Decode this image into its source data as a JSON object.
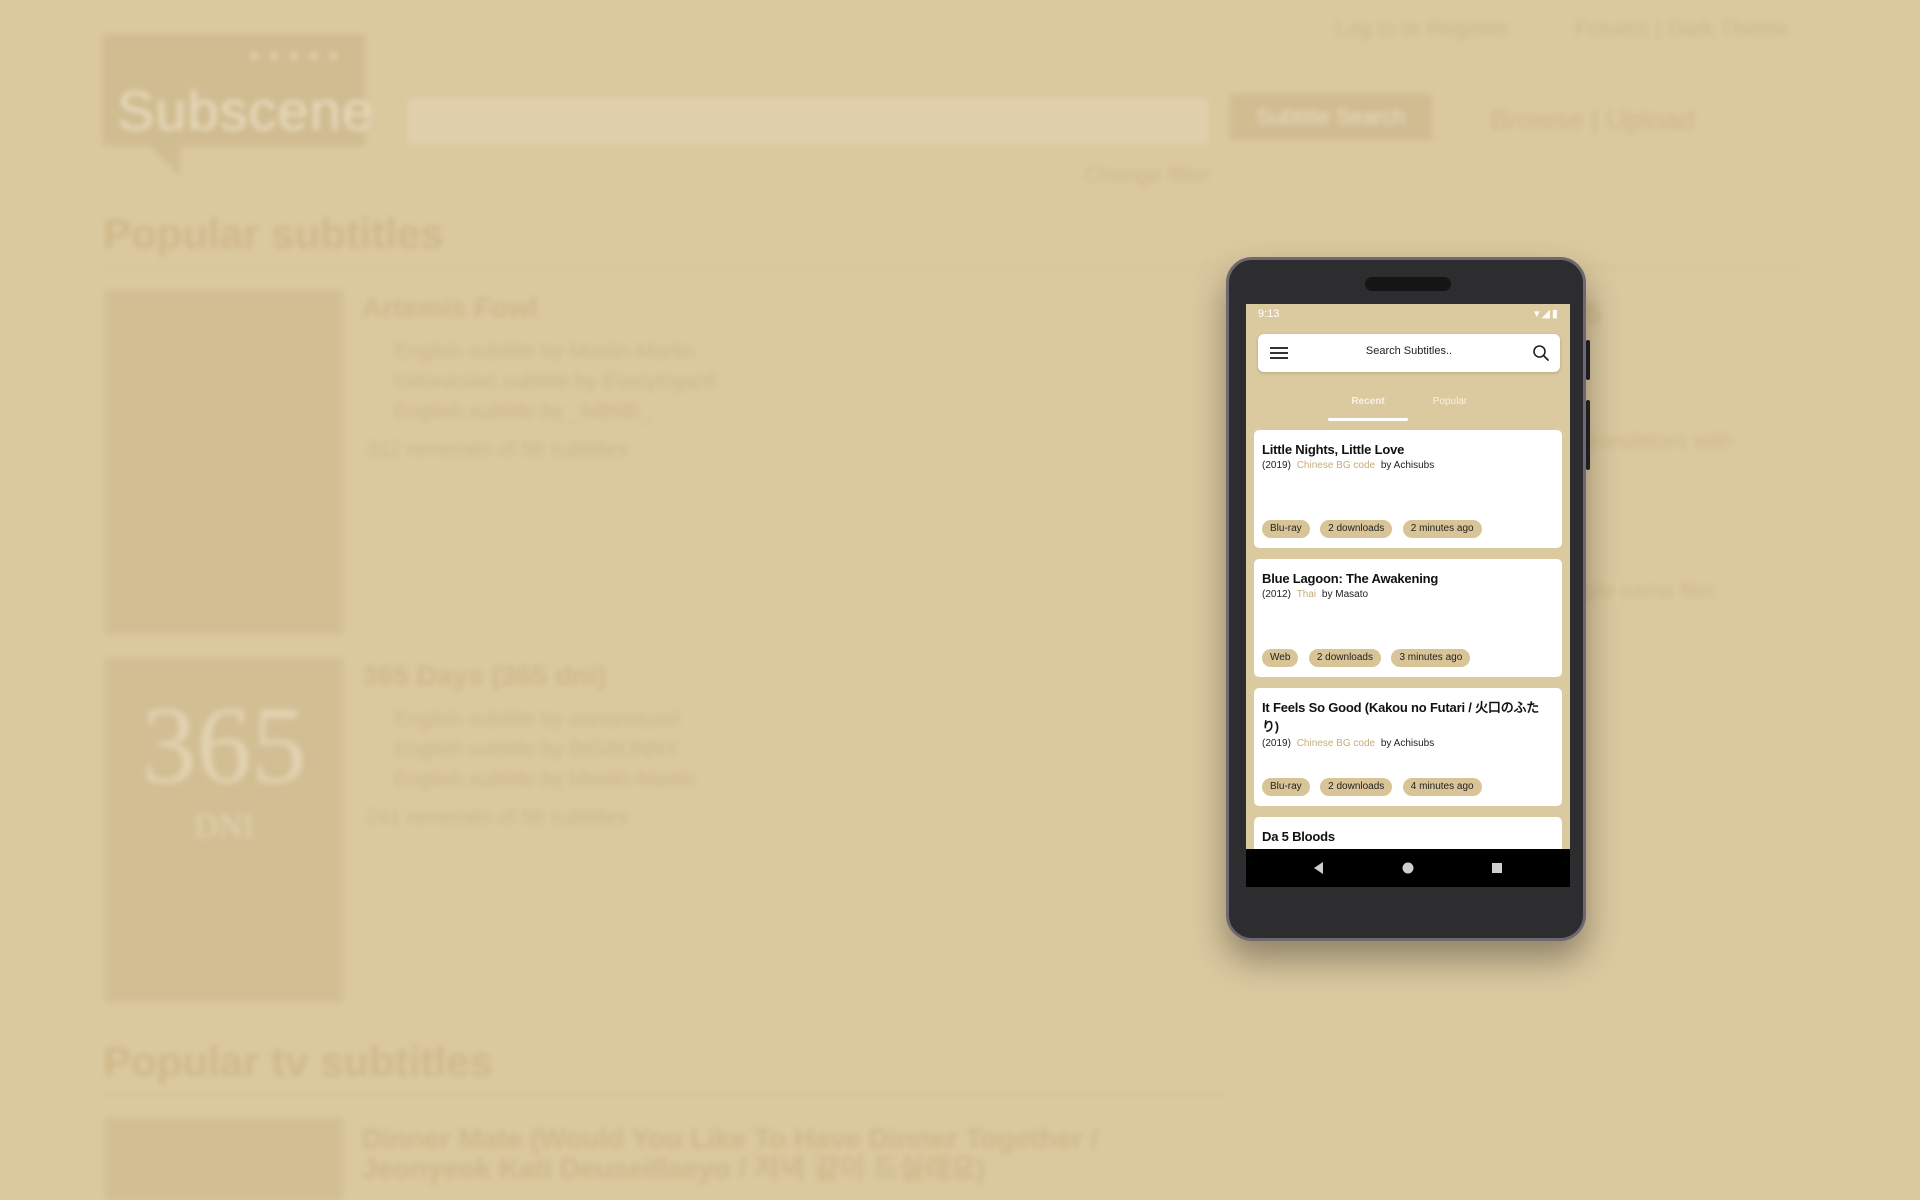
{
  "background_site": {
    "logo_stars": "★★★★★",
    "logo_name": "Subscene",
    "search_button": "Subtitle Search",
    "change_filter": "Change filter",
    "top_links": [
      "Log in or Register",
      "Forums | Dark Theme"
    ],
    "browse_upload": "Browse  |  Upload",
    "section_popular": "Popular subtitles",
    "section_tv": "Popular tv subtitles",
    "movie1": {
      "title": "Artemis Fowl",
      "lines": [
        "English subtitle by Moviin-Martin",
        "Indonesian subtitle by Everyingard",
        "English subtitle by _NBNB_"
      ],
      "count": "312 removals of 58 subtitles"
    },
    "movie2": {
      "title": "365 Days (365 dni)",
      "poster_text": "365",
      "poster_sub": "DNI",
      "lines": [
        "English subtitle by annamaurel",
        "English subtitle by BIGBUNNY",
        "English subtitle by Moviin-Martin"
      ],
      "count": "241 removals of 58 subtitles"
    },
    "movie3": {
      "title": "Dinner Mate (Would You Like To Have Dinner Together / Jeonyeok Kati Deuseillaeyo / 저녁 같이 드실래요)"
    },
    "side_fragments": [
      "5",
      "translators with",
      "ple same film"
    ]
  },
  "phone": {
    "status_time": "9:13",
    "status_icons": "▾◢▮",
    "search_placeholder": "Search Subtitles..",
    "tabs": [
      "Recent",
      "Popular"
    ],
    "items": [
      {
        "title": "Little Nights, Little Love",
        "year": "(2019)",
        "language": "Chinese BG code",
        "author": "by Achisubs",
        "chips": [
          "Blu-ray",
          "2 downloads",
          "2 minutes ago"
        ]
      },
      {
        "title": "Blue Lagoon: The Awakening",
        "year": "(2012)",
        "language": "Thai",
        "author": "by Masato",
        "chips": [
          "Web",
          "2 downloads",
          "3 minutes ago"
        ]
      },
      {
        "title": "It Feels So Good (Kakou no Futari / 火口のふたり)",
        "year": "(2019)",
        "language": "Chinese BG code",
        "author": "by Achisubs",
        "chips": [
          "Blu-ray",
          "2 downloads",
          "4 minutes ago"
        ]
      },
      {
        "title": "Da 5 Bloods"
      }
    ],
    "nav": [
      "back",
      "home",
      "recents"
    ]
  },
  "colors": {
    "background": "#dac89f",
    "accent_chip": "#d8c497",
    "language_text": "#c7ad79"
  }
}
